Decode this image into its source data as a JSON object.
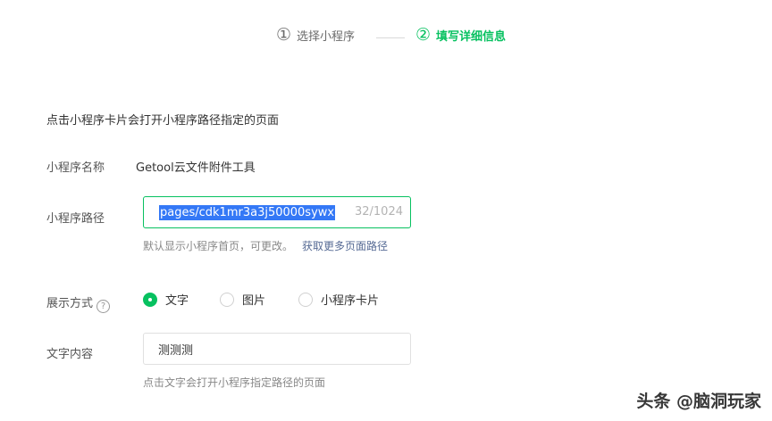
{
  "steps": [
    {
      "num": "①",
      "label": "选择小程序"
    },
    {
      "num": "②",
      "label": "填写详细信息"
    }
  ],
  "description": "点击小程序卡片会打开小程序路径指定的页面",
  "name_row": {
    "label": "小程序名称",
    "value": "Getool云文件附件工具"
  },
  "path_row": {
    "label": "小程序路径",
    "value": "pages/cdk1mr3a3j50000sywx",
    "count": "32/1024",
    "hint": "默认显示小程序首页，可更改。",
    "link": "获取更多页面路径"
  },
  "display_row": {
    "label": "展示方式",
    "help_icon": "?",
    "options": [
      "文字",
      "图片",
      "小程序卡片"
    ],
    "selected": "文字"
  },
  "text_row": {
    "label": "文字内容",
    "value": "测测测",
    "hint": "点击文字会打开小程序指定路径的页面"
  },
  "watermark": "头条 @脑洞玩家",
  "colors": {
    "accent": "#07c160",
    "link": "#576b95",
    "selection": "#3478f6"
  }
}
